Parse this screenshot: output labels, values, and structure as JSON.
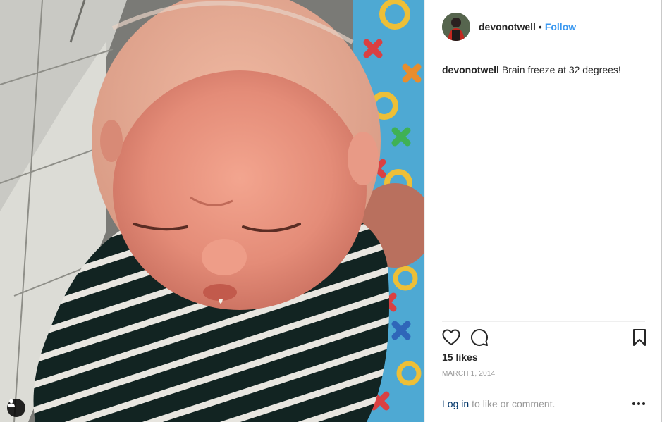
{
  "post": {
    "username": "devonotwell",
    "separator": "•",
    "follow_label": "Follow",
    "caption_user": "devonotwell",
    "caption_text": "Brain freeze at 32 degrees!",
    "likes": "15 likes",
    "date": "MARCH 1, 2014",
    "login_label": "Log in",
    "login_suffix": "to like or comment.",
    "icons": [
      "heart-icon",
      "comment-icon",
      "bookmark-icon",
      "more-options-icon",
      "user-tag-icon"
    ]
  },
  "colors": {
    "follow": "#3897f0",
    "login_link": "#003569",
    "muted": "#999999",
    "divider": "#efefef"
  }
}
